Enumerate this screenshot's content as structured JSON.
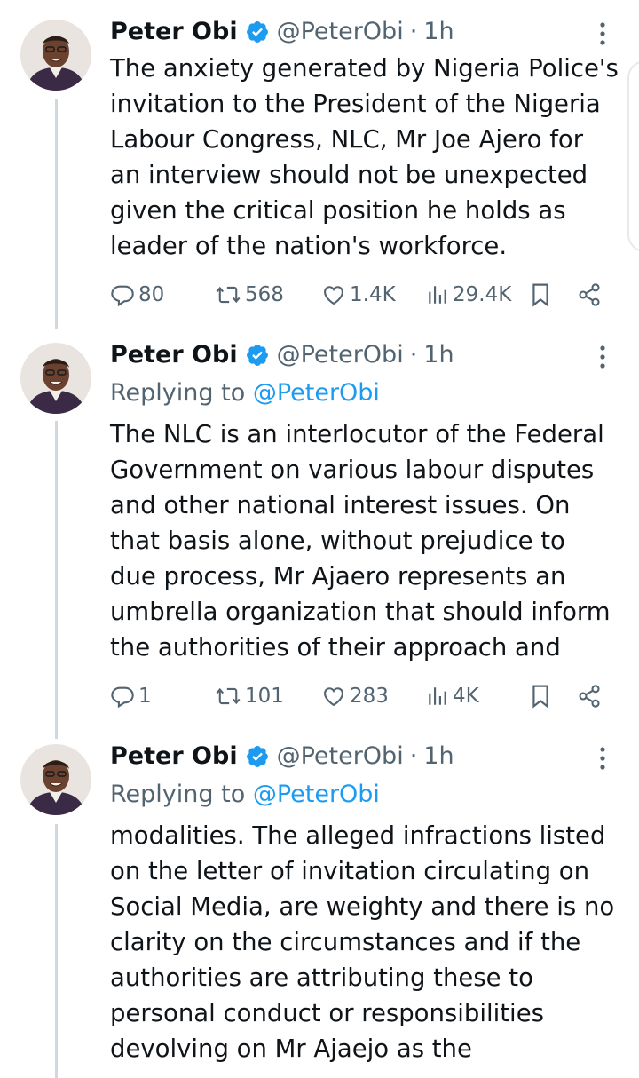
{
  "tweets": [
    {
      "display_name": "Peter Obi",
      "handle": "@PeterObi",
      "separator": "·",
      "time": "1h",
      "replying_prefix": "",
      "replying_to": "",
      "text_lines": [
        "The anxiety generated by Nigeria Police's",
        "invitation to the President of the Nigeria",
        "Labour Congress, NLC, Mr Joe Ajero for",
        "an interview should not be unexpected",
        "given the critical position he holds as",
        "leader of the nation's workforce."
      ],
      "replies": "80",
      "retweets": "568",
      "likes": "1.4K",
      "views": "29.4K"
    },
    {
      "display_name": "Peter Obi",
      "handle": "@PeterObi",
      "separator": "·",
      "time": "1h",
      "replying_prefix": "Replying to",
      "replying_to": "@PeterObi",
      "text_lines": [
        "The NLC is an interlocutor of the Federal",
        "Government on various labour disputes",
        "and other national interest issues. On",
        "that basis alone, without prejudice to",
        "due process, Mr Ajaero represents an",
        "umbrella organization that should inform",
        "the authorities of their approach and"
      ],
      "replies": "1",
      "retweets": "101",
      "likes": "283",
      "views": "4K"
    },
    {
      "display_name": "Peter Obi",
      "handle": "@PeterObi",
      "separator": "·",
      "time": "1h",
      "replying_prefix": "Replying to",
      "replying_to": "@PeterObi",
      "text_lines": [
        "modalities. The alleged infractions listed",
        "on the letter of invitation circulating on",
        "Social Media, are weighty and there is no",
        "clarity on the circumstances and if the",
        "authorities are attributing these to",
        "personal conduct or responsibilities",
        "devolving on Mr Ajaejo as the"
      ]
    }
  ],
  "icons": {
    "verified": "verified-badge-icon",
    "more": "more-options-icon",
    "reply": "reply-icon",
    "retweet": "retweet-icon",
    "like": "heart-icon",
    "views": "views-chart-icon",
    "bookmark": "bookmark-icon",
    "share": "share-icon"
  },
  "colors": {
    "text": "#0f1419",
    "secondary": "#536471",
    "accent": "#1d9bf0",
    "thread_line": "#cfd9de"
  }
}
